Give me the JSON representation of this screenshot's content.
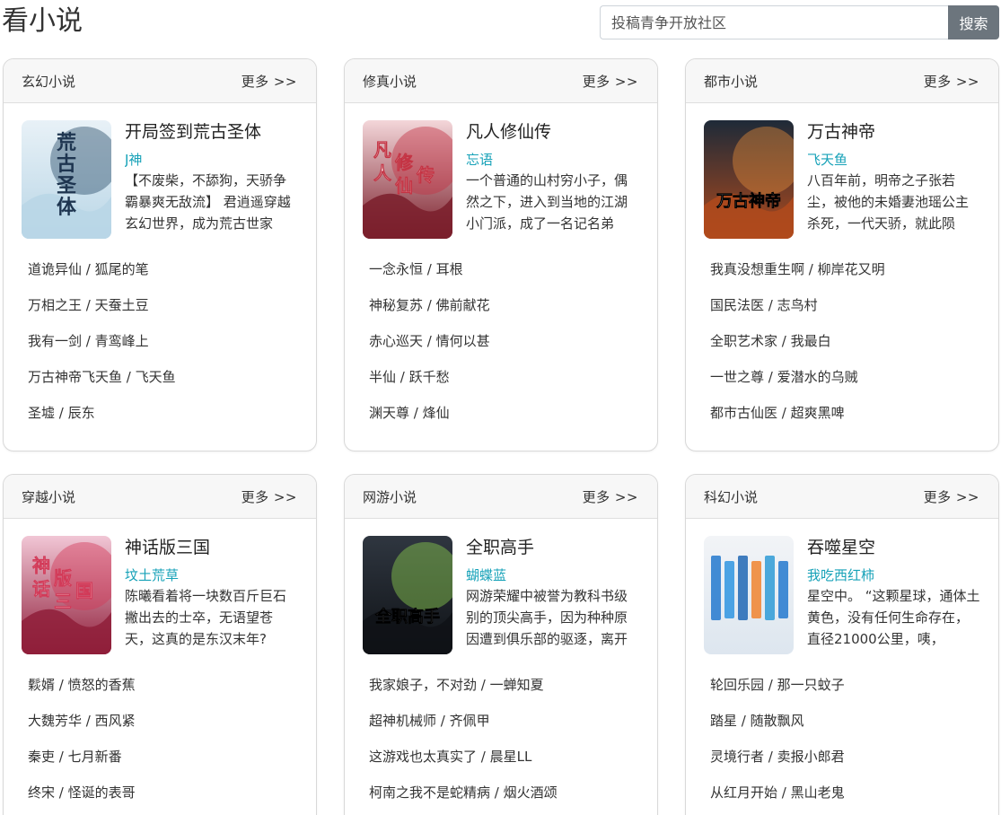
{
  "site_title": "看小说",
  "search": {
    "placeholder": "投稿青争开放社区",
    "button_label": "搜索"
  },
  "sections": [
    {
      "title": "玄幻小说",
      "more_label": "更多 >>",
      "featured": {
        "title": "开局签到荒古圣体",
        "author": "J神",
        "desc": "【不废柴，不舔狗，天骄争霸暴爽无敌流】 君逍遥穿越玄幻世界，成为荒古世家",
        "cover_text": "荒古圣体"
      },
      "books": [
        {
          "title": "道诡异仙",
          "author": "狐尾的笔"
        },
        {
          "title": "万相之王",
          "author": "天蚕土豆"
        },
        {
          "title": "我有一剑",
          "author": "青鸾峰上"
        },
        {
          "title": "万古神帝飞天鱼",
          "author": "飞天鱼"
        },
        {
          "title": "圣墟",
          "author": "辰东"
        }
      ]
    },
    {
      "title": "修真小说",
      "more_label": "更多 >>",
      "featured": {
        "title": "凡人修仙传",
        "author": "忘语",
        "desc": "一个普通的山村穷小子，偶然之下，进入到当地的江湖小门派，成了一名记名弟",
        "cover_text": "凡人修仙传"
      },
      "books": [
        {
          "title": "一念永恒",
          "author": "耳根"
        },
        {
          "title": "神秘复苏",
          "author": "佛前献花"
        },
        {
          "title": "赤心巡天",
          "author": "情何以甚"
        },
        {
          "title": "半仙",
          "author": "跃千愁"
        },
        {
          "title": "渊天尊",
          "author": "烽仙"
        }
      ]
    },
    {
      "title": "都市小说",
      "more_label": "更多 >>",
      "featured": {
        "title": "万古神帝",
        "author": "飞天鱼",
        "desc": "八百年前，明帝之子张若尘，被他的未婚妻池瑶公主杀死，一代天骄，就此陨",
        "cover_text": "万古神帝"
      },
      "books": [
        {
          "title": "我真没想重生啊",
          "author": "柳岸花又明"
        },
        {
          "title": "国民法医",
          "author": "志鸟村"
        },
        {
          "title": "全职艺术家",
          "author": "我最白"
        },
        {
          "title": "一世之尊",
          "author": "爱潜水的乌贼"
        },
        {
          "title": "都市古仙医",
          "author": "超爽黑啤"
        }
      ]
    },
    {
      "title": "穿越小说",
      "more_label": "更多 >>",
      "featured": {
        "title": "神话版三国",
        "author": "坟土荒草",
        "desc": "陈曦看着将一块数百斤巨石撇出去的士卒，无语望苍天，这真的是东汉末年?",
        "cover_text": "神话版三国"
      },
      "books": [
        {
          "title": "鬏婿",
          "author": "愤怒的香蕉"
        },
        {
          "title": "大魏芳华",
          "author": "西风紧"
        },
        {
          "title": "秦吏",
          "author": "七月新番"
        },
        {
          "title": "终宋",
          "author": "怪诞的表哥"
        }
      ]
    },
    {
      "title": "网游小说",
      "more_label": "更多 >>",
      "featured": {
        "title": "全职高手",
        "author": "蝴蝶蓝",
        "desc": "网游荣耀中被誉为教科书级别的顶尖高手，因为种种原因遭到俱乐部的驱逐，离开",
        "cover_text": "全职高手"
      },
      "books": [
        {
          "title": "我家娘子，不对劲",
          "author": "一蝉知夏"
        },
        {
          "title": "超神机械师",
          "author": "齐佩甲"
        },
        {
          "title": "这游戏也太真实了",
          "author": "晨星LL"
        },
        {
          "title": "柯南之我不是蛇精病",
          "author": "烟火酒颂"
        }
      ]
    },
    {
      "title": "科幻小说",
      "more_label": "更多 >>",
      "featured": {
        "title": "吞噬星空",
        "author": "我吃西红柿",
        "desc": "星空中。 “这颗星球，通体土黄色，没有任何生命存在，直径21000公里，咦，",
        "cover_text": ""
      },
      "books": [
        {
          "title": "轮回乐园",
          "author": "那一只蚊子"
        },
        {
          "title": "踏星",
          "author": "随散飘风"
        },
        {
          "title": "灵境行者",
          "author": "卖报小郎君"
        },
        {
          "title": "从红月开始",
          "author": "黑山老鬼"
        }
      ]
    }
  ],
  "colors": {
    "author": "#17a2b8",
    "search_button": "#6c757d",
    "card_header": "#f7f7f7"
  }
}
